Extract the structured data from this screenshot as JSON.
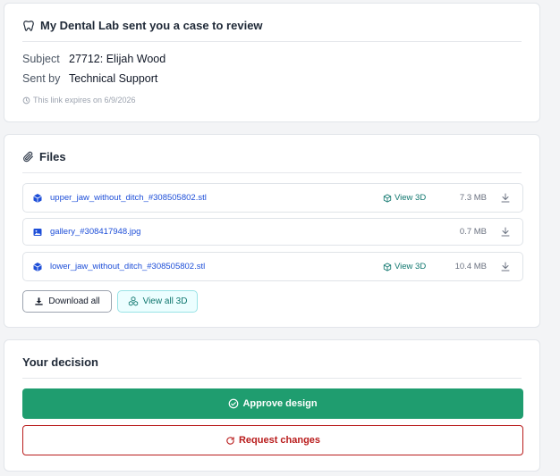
{
  "header": {
    "title": "My Dental Lab sent you a case to review",
    "subject_label": "Subject",
    "subject_value": "27712: Elijah Wood",
    "sent_by_label": "Sent by",
    "sent_by_value": "Technical Support",
    "expiry_text": "This link expires on 6/9/2026"
  },
  "files": {
    "title": "Files",
    "view_3d_label": "View 3D",
    "items": [
      {
        "name": "upper_jaw_without_ditch_#308505802.stl",
        "size": "7.3 MB",
        "type": "model",
        "icon": "cube-icon",
        "has_3d": true
      },
      {
        "name": "gallery_#308417948.jpg",
        "size": "0.7 MB",
        "type": "image",
        "icon": "image-icon",
        "has_3d": false
      },
      {
        "name": "lower_jaw_without_ditch_#308505802.stl",
        "size": "10.4 MB",
        "type": "model",
        "icon": "cube-icon",
        "has_3d": true
      }
    ],
    "download_all_label": "Download all",
    "view_all_3d_label": "View all 3D"
  },
  "decision": {
    "title": "Your decision",
    "approve_label": "Approve design",
    "request_label": "Request changes"
  },
  "colors": {
    "approve": "#1f9d6f",
    "request": "#b91c1c",
    "file_link": "#1d4ed8",
    "view_3d": "#0f766e"
  }
}
